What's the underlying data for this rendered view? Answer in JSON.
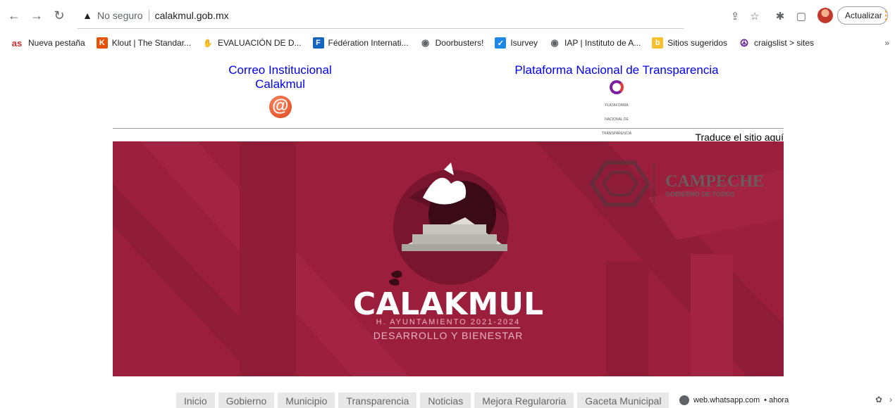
{
  "browser": {
    "security_text": "No seguro",
    "url": "calakmul.gob.mx",
    "update_label": "Actualizar",
    "icons": [
      "back-icon",
      "forward-icon",
      "reload-icon",
      "warning-icon",
      "share-icon",
      "star-icon",
      "extensions-icon",
      "sidepanel-icon",
      "profile-avatar",
      "menu-icon"
    ]
  },
  "bookmarks": [
    {
      "label": "Nueva pestaña",
      "icon": "as",
      "color": "#d32f2f"
    },
    {
      "label": "Klout | The Standar...",
      "icon": "K",
      "color": "#e65100"
    },
    {
      "label": "EVALUACIÓN DE D...",
      "icon": "✋",
      "color": "#f9a825"
    },
    {
      "label": "Fédération Internati...",
      "icon": "F",
      "color": "#1565c0"
    },
    {
      "label": "Doorbusters!",
      "icon": "◉",
      "color": "#5f6368"
    },
    {
      "label": "Isurvey",
      "icon": "✓",
      "color": "#1e88e5"
    },
    {
      "label": "IAP | Instituto de A...",
      "icon": "◉",
      "color": "#5f6368"
    },
    {
      "label": "Sitios sugeridos",
      "icon": "b",
      "color": "#fbc02d"
    },
    {
      "label": "craigslist > sites",
      "icon": "☮",
      "color": "#6a1b9a"
    }
  ],
  "bookmarks_more": "»",
  "header_links": {
    "correo_line1": "Correo Institucional",
    "correo_line2": "Calakmul",
    "correo_icon": "@",
    "plataforma": "Plataforma Nacional de Transparencia",
    "plataforma_logo_text": "PLATAFORMA NACIONAL DE TRANSPARENCIA"
  },
  "translate_label": "Traduce el sitio aquí",
  "banner": {
    "title": "CALAKMUL",
    "subtitle": "H. AYUNTAMIENTO 2021-2024",
    "tagline": "DESARROLLO Y BIENESTAR",
    "campeche": "CAMPECHE",
    "campeche_sub": "GOBIERNO DE TODOS",
    "bg_color": "#9b1f3d"
  },
  "nav": [
    "Inicio",
    "Gobierno",
    "Municipio",
    "Transparencia",
    "Noticias",
    "Mejora Regularoria",
    "Gaceta Municipal"
  ],
  "notification": {
    "source": "web.whatsapp.com",
    "time": "• ahora"
  }
}
